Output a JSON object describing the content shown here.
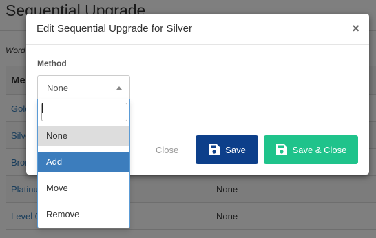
{
  "background": {
    "page_title": "Sequential Upgrade",
    "note": "Word",
    "table_header": "Me",
    "rows": [
      {
        "name": "Gold",
        "method": ""
      },
      {
        "name": "Silve",
        "method": ""
      },
      {
        "name": "Bron",
        "method": ""
      },
      {
        "name": "Platinu",
        "method": "None"
      },
      {
        "name": "Level 0",
        "method": "None"
      }
    ]
  },
  "modal": {
    "title": "Edit Sequential Upgrade for Silver",
    "close_symbol": "×",
    "method_label": "Method",
    "select_value": "None"
  },
  "dropdown": {
    "search_value": "",
    "options": [
      "None",
      "Add",
      "Move",
      "Remove"
    ],
    "selected": "None",
    "highlighted": "Add"
  },
  "footer": {
    "close_label": "Close",
    "save_label": "Save",
    "save_close_label": "Save & Close"
  },
  "colors": {
    "save_button": "#0d3f8a",
    "save_close_button": "#1fc38b",
    "highlight": "#3c7dbd"
  },
  "icons": {
    "save": "floppy-disk-icon",
    "caret": "caret-up-icon",
    "close": "close-icon"
  }
}
